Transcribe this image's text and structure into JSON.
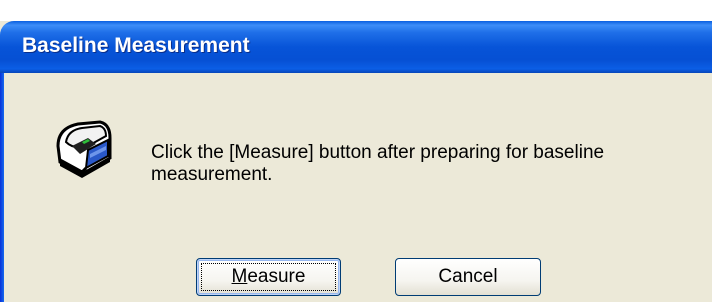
{
  "window": {
    "title": "Baseline Measurement"
  },
  "dialog": {
    "icon": "measurement-device-icon",
    "message_line1": "Click the [Measure] button after preparing for baseline",
    "message_line2": "measurement."
  },
  "buttons": {
    "measure_accel": "M",
    "measure_rest": "easure",
    "cancel_label": "Cancel"
  },
  "colors": {
    "titlebar": "#0754d8",
    "dialog_bg": "#ece9d8",
    "button_border": "#003c74"
  }
}
